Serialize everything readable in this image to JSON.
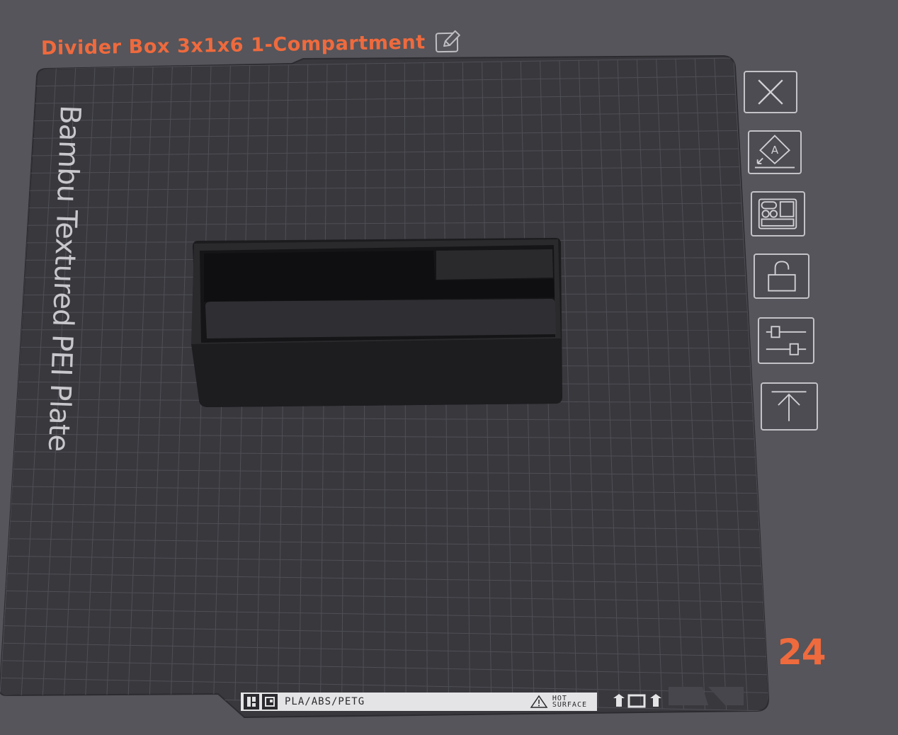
{
  "plate": {
    "title": "Divider Box 3x1x6 1-Compartment",
    "bed_label": "Bambu Textured PEI Plate",
    "plate_number": "24",
    "sticker": {
      "materials": "PLA/ABS/PETG",
      "warning": "HOT\nSURFACE"
    }
  },
  "toolbar": {
    "buttons": [
      {
        "name": "close-button",
        "icon": "close-icon"
      },
      {
        "name": "auto-orient-button",
        "icon": "auto-orient-icon",
        "glyph": "A"
      },
      {
        "name": "arrange-button",
        "icon": "arrange-icon"
      },
      {
        "name": "lock-button",
        "icon": "unlock-icon"
      },
      {
        "name": "plate-settings-button",
        "icon": "sliders-icon"
      },
      {
        "name": "move-to-top-button",
        "icon": "move-to-top-icon"
      }
    ]
  },
  "colors": {
    "background": "#55555b",
    "bed": "#38383d",
    "grid": "#4e4e55",
    "accent": "#ef6a3d",
    "bed_text": "#c8c8cc",
    "object": "#1f1f22"
  }
}
